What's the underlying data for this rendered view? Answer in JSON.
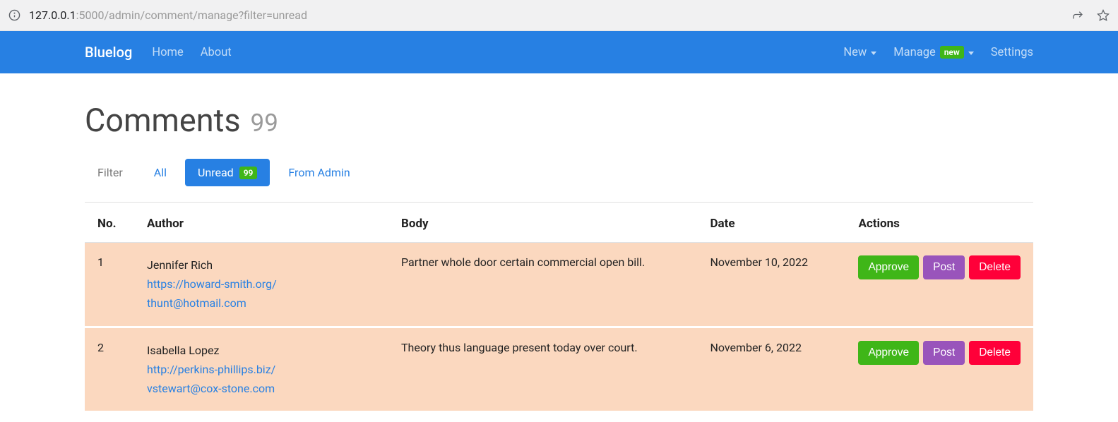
{
  "browser": {
    "url_host": "127.0.0.1",
    "url_port_path": ":5000/admin/comment/manage?filter=unread"
  },
  "navbar": {
    "brand": "Bluelog",
    "left": [
      {
        "label": "Home"
      },
      {
        "label": "About"
      }
    ],
    "right": {
      "new": "New",
      "manage": "Manage",
      "manage_badge": "new",
      "settings": "Settings"
    }
  },
  "page": {
    "title": "Comments",
    "count": "99"
  },
  "filter": {
    "label": "Filter",
    "tabs": {
      "all": "All",
      "unread": "Unread",
      "unread_badge": "99",
      "from_admin": "From Admin"
    }
  },
  "table": {
    "headers": {
      "no": "No.",
      "author": "Author",
      "body": "Body",
      "date": "Date",
      "actions": "Actions"
    },
    "actions": {
      "approve": "Approve",
      "post": "Post",
      "delete": "Delete"
    },
    "rows": [
      {
        "no": "1",
        "author_name": "Jennifer Rich",
        "author_url": "https://howard-smith.org/",
        "author_email": "thunt@hotmail.com",
        "body": "Partner whole door certain commercial open bill.",
        "date": "November 10, 2022"
      },
      {
        "no": "2",
        "author_name": "Isabella Lopez",
        "author_url": "http://perkins-phillips.biz/",
        "author_email": "vstewart@cox-stone.com",
        "body": "Theory thus language present today over court.",
        "date": "November 6, 2022"
      }
    ]
  }
}
